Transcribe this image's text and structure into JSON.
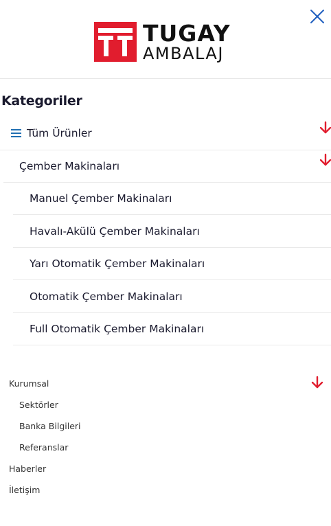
{
  "brand": {
    "name_top": "TUGAY",
    "name_bottom": "AMBALAJ",
    "logo_color": "#e11d2e"
  },
  "header": {
    "close_icon": "close-icon",
    "accent_color": "#1f5fbf"
  },
  "categories": {
    "title": "Kategoriler",
    "all_products": {
      "label": "Tüm Ürünler",
      "icon": "hamburger-icon"
    },
    "group": {
      "label": "Çember Makinaları",
      "items": [
        {
          "label": "Manuel Çember Makinaları"
        },
        {
          "label": "Havalı-Akülü Çember Makinaları"
        },
        {
          "label": "Yarı Otomatik Çember Makinaları"
        },
        {
          "label": "Otomatik Çember Makinaları"
        },
        {
          "label": "Full Otomatik Çember Makinaları"
        }
      ]
    },
    "expand_icon": "arrow-down-icon",
    "expand_color": "#e11d2e"
  },
  "nav": {
    "kurumsal": {
      "label": "Kurumsal",
      "items": [
        {
          "label": "Sektörler"
        },
        {
          "label": "Banka Bilgileri"
        },
        {
          "label": "Referanslar"
        }
      ]
    },
    "haberler": "Haberler",
    "iletisim": "İletişim"
  }
}
